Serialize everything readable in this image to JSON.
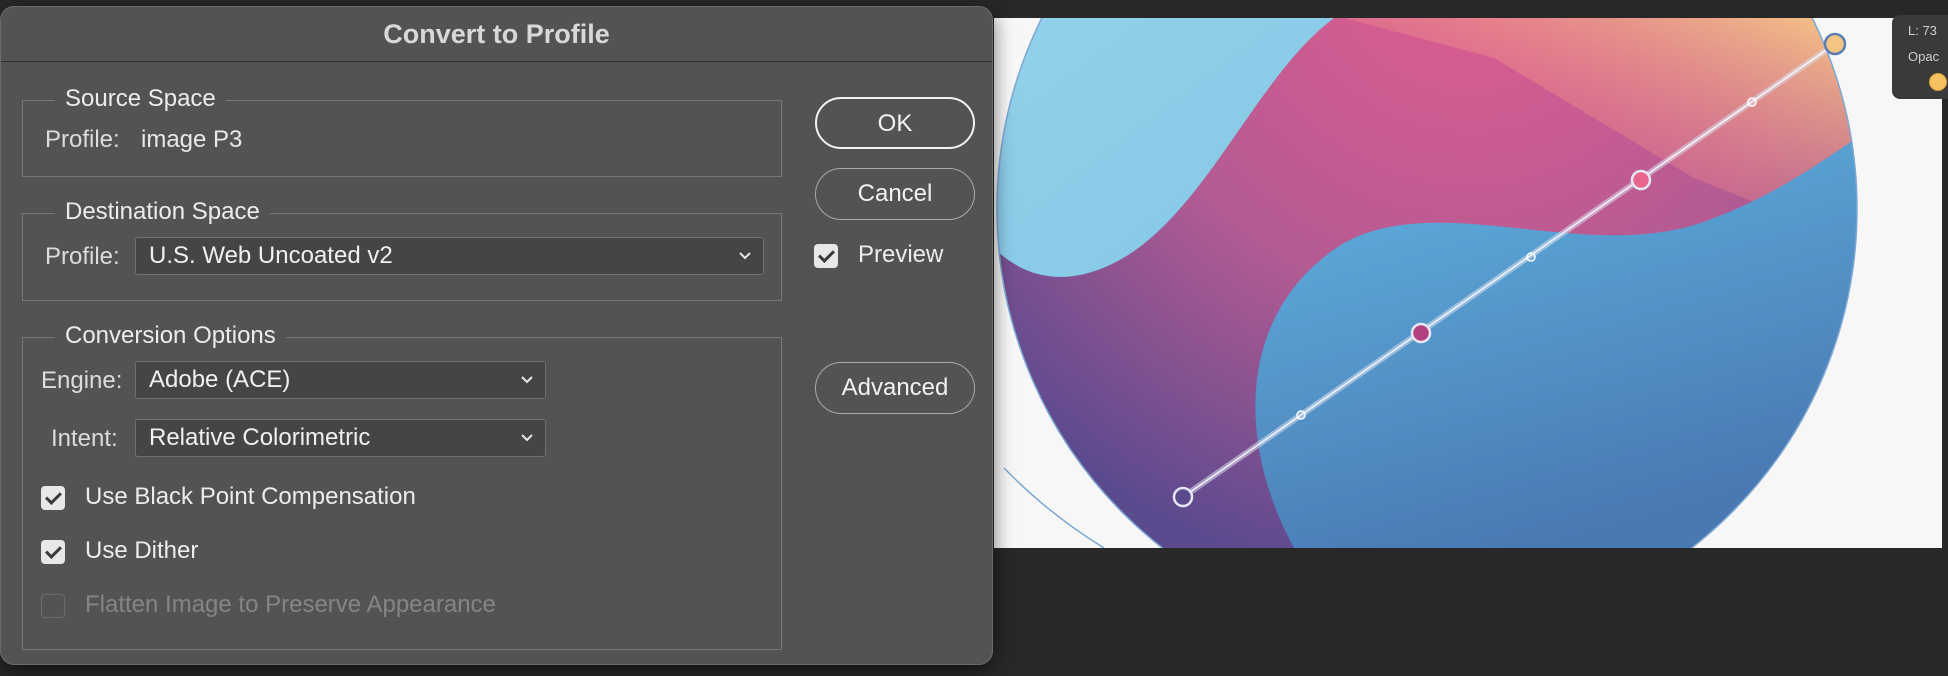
{
  "dialog": {
    "title": "Convert to Profile",
    "source_space": {
      "legend": "Source Space",
      "profile_label": "Profile:",
      "profile_value": "image P3"
    },
    "destination_space": {
      "legend": "Destination Space",
      "profile_label": "Profile:",
      "profile_value": "U.S. Web Uncoated v2"
    },
    "conversion_options": {
      "legend": "Conversion Options",
      "engine_label": "Engine:",
      "engine_value": "Adobe (ACE)",
      "intent_label": "Intent:",
      "intent_value": "Relative Colorimetric",
      "black_point": {
        "label": "Use Black Point Compensation",
        "checked": true
      },
      "dither": {
        "label": "Use Dither",
        "checked": true
      },
      "flatten": {
        "label": "Flatten Image to Preserve Appearance",
        "checked": false,
        "enabled": false
      }
    },
    "buttons": {
      "ok": "OK",
      "cancel": "Cancel",
      "advanced": "Advanced"
    },
    "preview": {
      "label": "Preview",
      "checked": true
    }
  },
  "info_panel": {
    "line1": "L: 73",
    "line2": "Opac"
  },
  "artwork": {
    "colors": {
      "light_blue": "#8fcfe8",
      "pink": "#e35c8f",
      "peach": "#f5b880",
      "purple": "#5b4a8e",
      "blue": "#4f95cf",
      "handle_stroke": "#d8dff0"
    },
    "icons": [
      "gradient-handle-icon",
      "gradient-midpoint-icon",
      "chevron-down-icon",
      "checkmark-icon"
    ]
  }
}
